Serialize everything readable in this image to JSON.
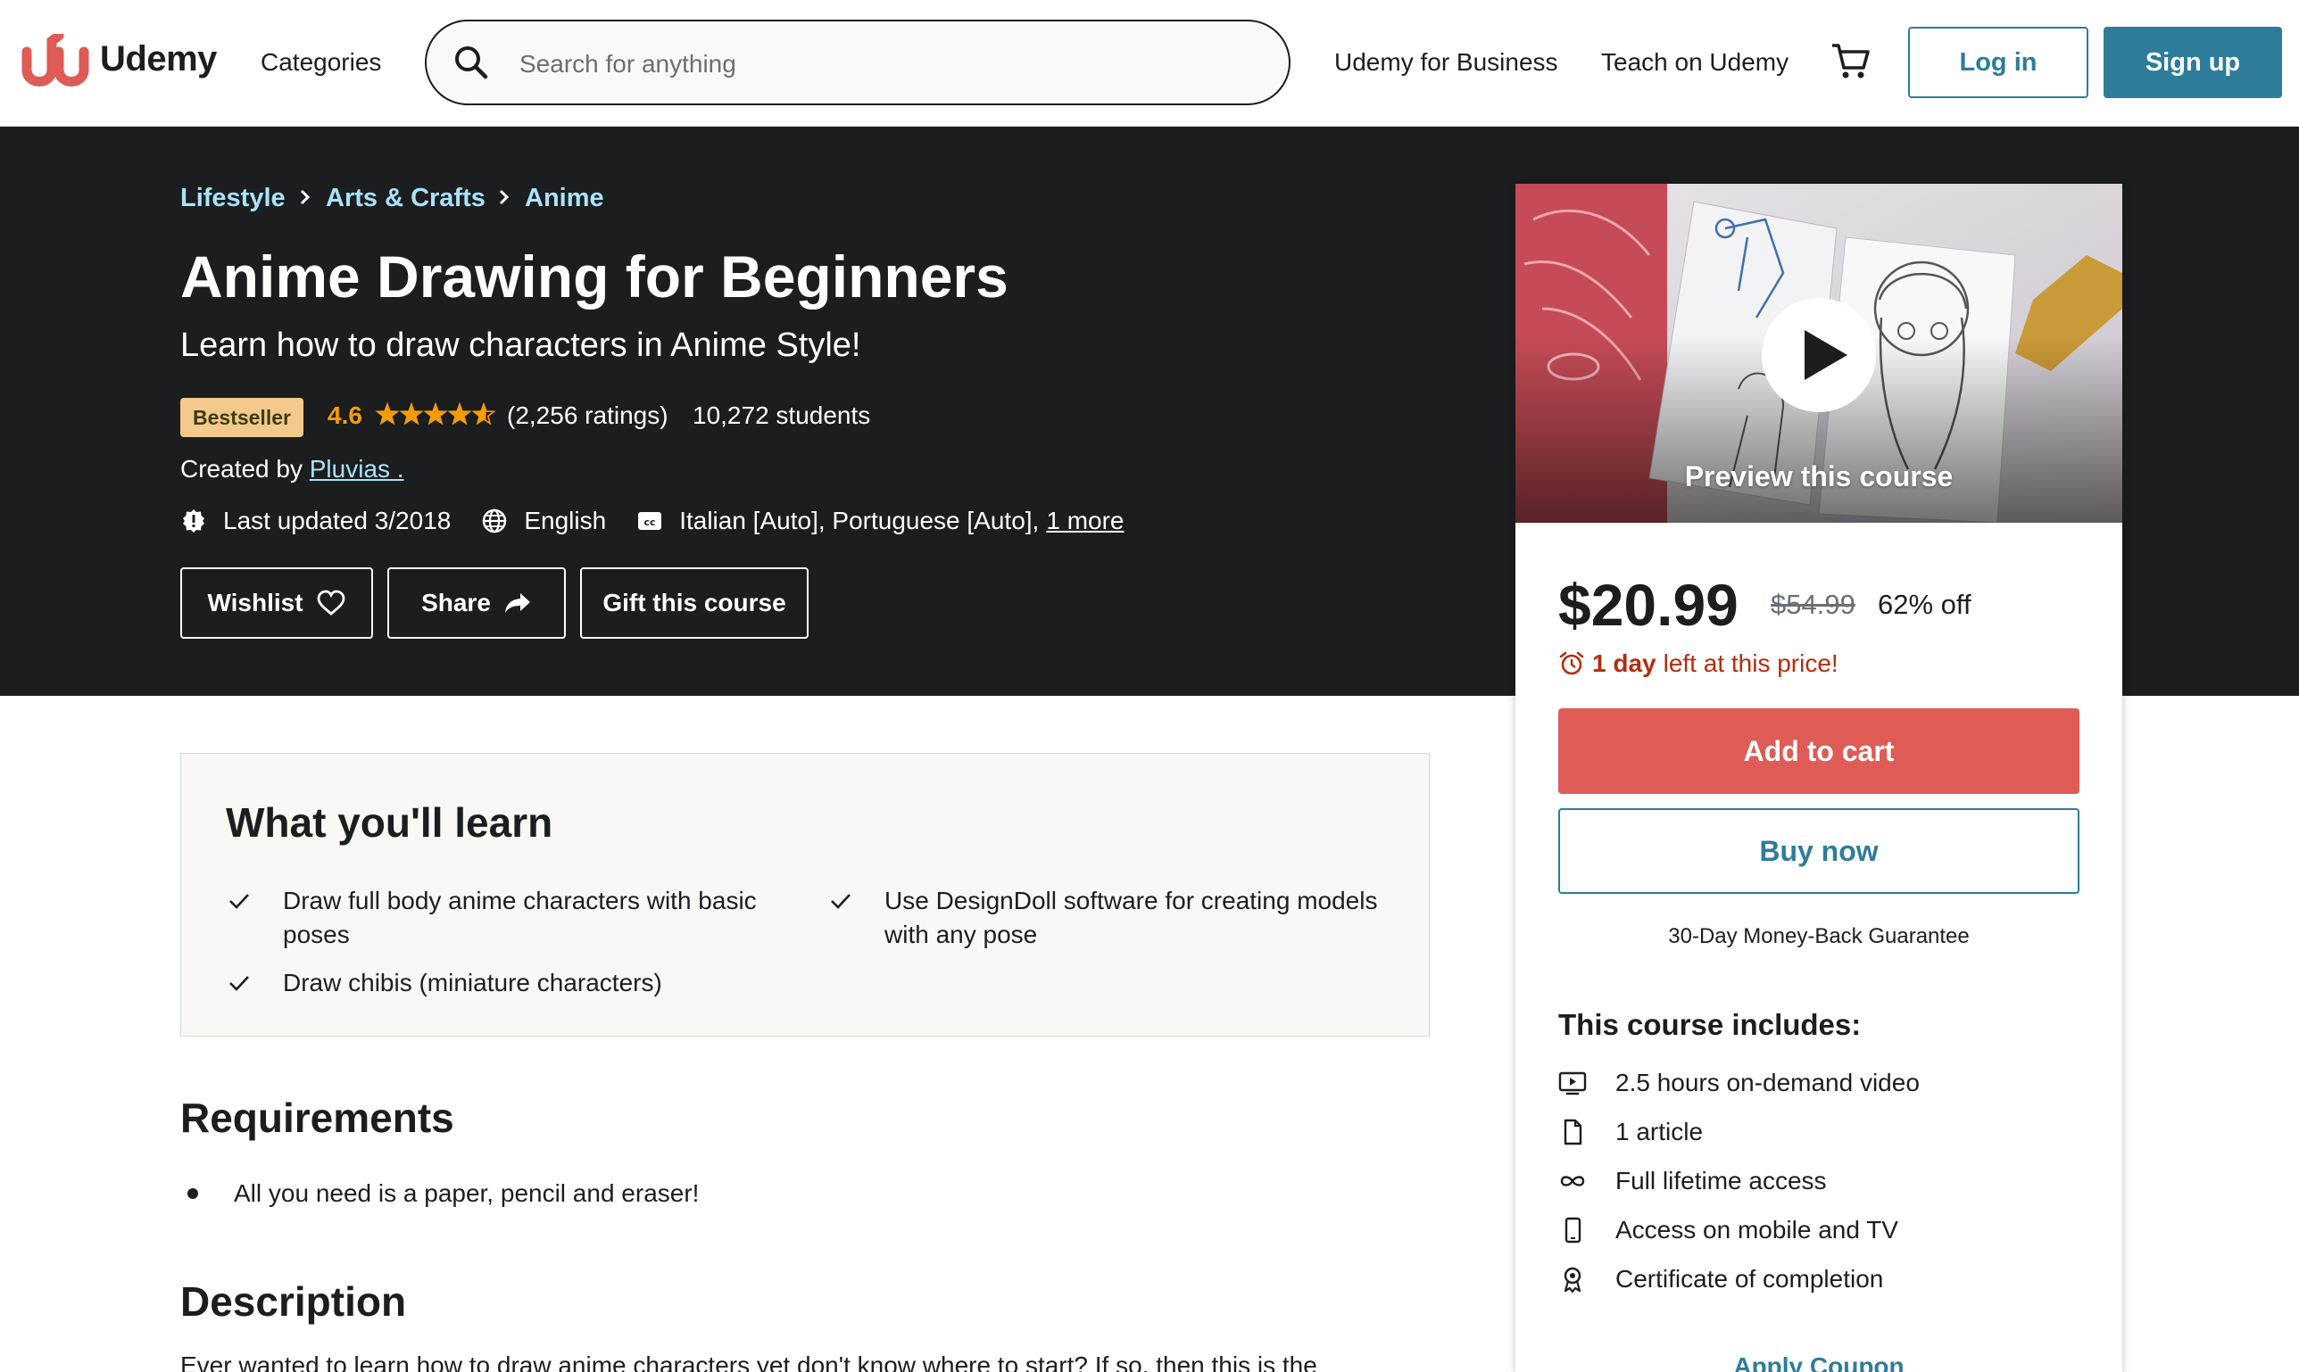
{
  "header": {
    "logo_text": "Udemy",
    "categories": "Categories",
    "search_placeholder": "Search for anything",
    "business": "Udemy for Business",
    "teach": "Teach on Udemy",
    "login": "Log in",
    "signup": "Sign up"
  },
  "breadcrumb": [
    "Lifestyle",
    "Arts & Crafts",
    "Anime"
  ],
  "course": {
    "title": "Anime Drawing for Beginners",
    "subtitle": "Learn how to draw characters in Anime Style!",
    "badge": "Bestseller",
    "rating": "4.6",
    "rating_stars": 4.6,
    "ratings_count": "(2,256 ratings)",
    "students": "10,272 students",
    "created_prefix": "Created by",
    "instructor": "Pluvias .",
    "last_updated": "Last updated 3/2018",
    "language": "English",
    "captions": "Italian [Auto], Portuguese [Auto],",
    "captions_more": "1 more"
  },
  "actions": {
    "wishlist": "Wishlist",
    "share": "Share",
    "gift": "Gift this course"
  },
  "sidebar": {
    "preview_label": "Preview this course",
    "price": "$20.99",
    "original_price": "$54.99",
    "discount": "62% off",
    "timer_bold": "1 day",
    "timer_rest": "left at this price!",
    "add_to_cart": "Add to cart",
    "buy_now": "Buy now",
    "guarantee": "30-Day Money-Back Guarantee",
    "includes_title": "This course includes:",
    "includes": [
      {
        "icon": "video-icon",
        "text": "2.5 hours on-demand video"
      },
      {
        "icon": "article-icon",
        "text": "1 article"
      },
      {
        "icon": "infinity-icon",
        "text": "Full lifetime access"
      },
      {
        "icon": "mobile-icon",
        "text": "Access on mobile and TV"
      },
      {
        "icon": "certificate-icon",
        "text": "Certificate of completion"
      }
    ],
    "coupon": "Apply Coupon"
  },
  "learn": {
    "title": "What you'll learn",
    "items": [
      "Draw full body anime characters with basic poses",
      "Use DesignDoll software for creating models with any pose",
      "Draw chibis (miniature characters)"
    ]
  },
  "requirements": {
    "title": "Requirements",
    "items": [
      "All you need is a paper, pencil and eraser!"
    ]
  },
  "description": {
    "title": "Description",
    "text": "Ever wanted to learn how to draw anime characters yet don't know where to start? If so, then this is the"
  },
  "colors": {
    "accent": "#2d7d9a",
    "cart_button": "#de5c55",
    "breadcrumb": "#a8e3fe",
    "star": "#f69c08",
    "hero_bg": "#1c1d1f"
  }
}
